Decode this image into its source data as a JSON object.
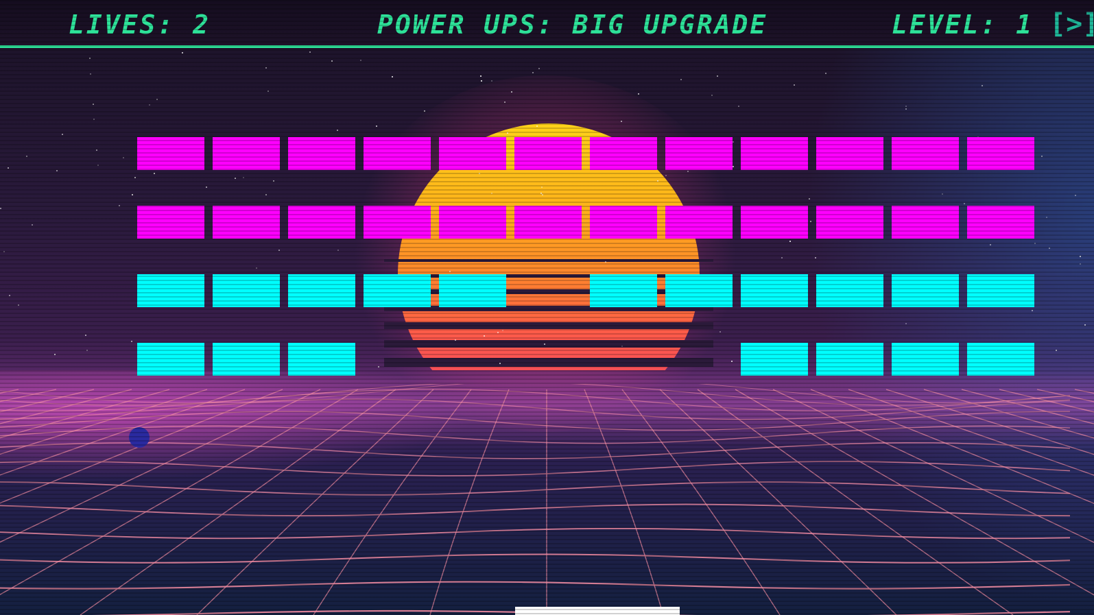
{
  "hud": {
    "lives_text": "LIVES: 2",
    "powerups_text": "POWER UPS: BIG UPGRADE",
    "level_text": "LEVEL: 1",
    "next_button_label": "[>]",
    "accent_color": "#2ee39a"
  },
  "game": {
    "lives": 2,
    "level": 1,
    "power_up": "BIG UPGRADE",
    "brick_colors": {
      "magenta": "#ff00ff",
      "cyan": "#00ffff"
    },
    "brick_rows": [
      {
        "color": "magenta",
        "present": [
          1,
          1,
          1,
          1,
          1,
          1,
          1,
          1,
          1,
          1,
          1,
          1
        ]
      },
      {
        "color": "magenta",
        "present": [
          1,
          1,
          1,
          1,
          1,
          1,
          1,
          1,
          1,
          1,
          1,
          1
        ]
      },
      {
        "color": "cyan",
        "present": [
          1,
          1,
          1,
          1,
          1,
          0,
          1,
          1,
          1,
          1,
          1,
          1
        ]
      },
      {
        "color": "cyan",
        "present": [
          1,
          1,
          1,
          0,
          0,
          0,
          0,
          0,
          1,
          1,
          1,
          1
        ]
      }
    ],
    "ball_color": "#2a2aa0",
    "paddle_color": "#ffffff"
  },
  "background": {
    "sun_colors": [
      "#ffd21a",
      "#ff8a2a",
      "#e8406a"
    ],
    "grid_color": "#f08aa0"
  }
}
